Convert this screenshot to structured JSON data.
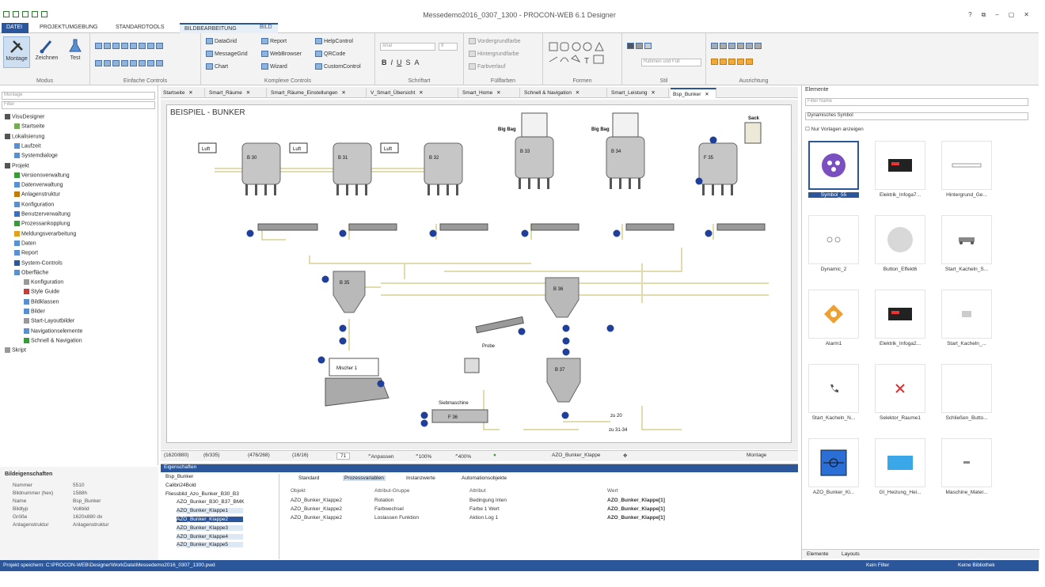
{
  "window": {
    "title": "Messedemo2016_0307_1300 - PROCON-WEB 6.1 Designer"
  },
  "ribbon_tabs": [
    "DATEI",
    "PROJEKTUMGEBUNG",
    "STANDARDTOOLS",
    "BILDBEARBEITUNG",
    "BILD"
  ],
  "ribbon": {
    "modus": {
      "label": "Modus",
      "buttons": [
        "Montage",
        "Zeichnen",
        "Test"
      ]
    },
    "einfache": {
      "label": "Einfache Controls"
    },
    "komplexe": {
      "label": "Komplexe Controls",
      "items": [
        "DataGrid",
        "MessageGrid",
        "Chart",
        "Report",
        "WebBrowser",
        "Wizard",
        "HelpControl",
        "QRCode",
        "CustomControl"
      ]
    },
    "schrift": {
      "label": "Schriftart",
      "font": "Arial",
      "size": "9"
    },
    "fuellfarben": {
      "label": "Füllfarben",
      "items": [
        "Vordergrundfarbe",
        "Hintergrundfarbe",
        "Farbverlauf"
      ]
    },
    "formen": {
      "label": "Formen"
    },
    "stil": {
      "label": "Stil",
      "rahmen": "Rahmen und Füll"
    },
    "ausrichtung": {
      "label": "Ausrichtung"
    }
  },
  "left": {
    "search_placeholder": "Montage",
    "filter_placeholder": "Filter",
    "tree": [
      "VisuDesigner",
      "Startseite",
      "Lokalisierung",
      "Laufzeit",
      "Systemdialoge",
      "Projekt",
      "Versionsverwaltung",
      "Datenverwaltung",
      "Anlagenstruktur",
      "Konfiguration",
      "Benutzerverwaltung",
      "Prozessankopplung",
      "Meldungsverarbeitung",
      "Daten",
      "Report",
      "System-Controls",
      "Oberfläche",
      "Konfiguration",
      "Style Guide",
      "Bildklassen",
      "Bilder",
      "Start-Layoutbilder",
      "Navigationselemente",
      "Schnell & Navigation",
      "Skript"
    ]
  },
  "props": {
    "title": "Bildeigenschaften",
    "rows": [
      {
        "k": "Nummer",
        "v": "5510"
      },
      {
        "k": "Bildnummer (hex)",
        "v": "1588h"
      },
      {
        "k": "Name",
        "v": "Bsp_Bunker"
      },
      {
        "k": "Bildtyp",
        "v": "Vollbild"
      },
      {
        "k": "Größe",
        "v": "1620x880 dx"
      },
      {
        "k": "Anlagenstruktur",
        "v": "Anlagenstruktur"
      }
    ]
  },
  "doc_tabs": [
    "Startseite",
    "Smart_Räume",
    "Smart_Räume_Einstellungen",
    "V_Smart_Übersicht",
    "Smart_Home",
    "Schnell & Navigation",
    "Smart_Leistung",
    "Bsp_Bunker"
  ],
  "drawing": {
    "title": "BEISPIEL - BUNKER",
    "labels": [
      "Big Bag",
      "Big Bag",
      "Sack",
      "Mischer 1",
      "Probe",
      "Siebmaschine",
      "zu 20",
      "zu 31-34"
    ],
    "tanks": [
      "B 30",
      "B 31",
      "B 32",
      "B 33",
      "B 34",
      "F 35",
      "B 36",
      "B 37"
    ],
    "luft": "Luft"
  },
  "status": {
    "coords1": "(1620/880)",
    "coords2": "(6/335)",
    "coords3": "(476/268)",
    "coords4": "(16/16)",
    "zoom_value": "71",
    "fit": "Anpassen",
    "zoom100": "100%",
    "zoom400": "400%",
    "selected": "AZO_Bunker_Klappe",
    "mode": "Montage"
  },
  "bottom": {
    "header": "Eigenschaften",
    "objects": [
      "Bsp_Bunker",
      "Calibri24Bold",
      "Fliessbild_Azo_Bunker_B30_B3",
      "AZO_Bunker_B30_B37_BMK",
      "AZO_Bunker_Klappe1",
      "AZO_Bunker_Klappe2",
      "AZO_Bunker_Klappe3",
      "AZO_Bunker_Klappe4",
      "AZO_Bunker_Klappe5"
    ],
    "tabs": [
      "Standard",
      "Prozessvariablen",
      "Instanzwerte",
      "Automationsobjekte"
    ],
    "columns": [
      "Objekt",
      "Attribut-Gruppe",
      "Attribut",
      "Wert"
    ],
    "rows": [
      [
        "AZO_Bunker_Klappe2",
        "Rotation",
        "Bedingung Inlen",
        "AZO_Bunker_Klappe[1]"
      ],
      [
        "AZO_Bunker_Klappe2",
        "Farbwechsel",
        "Farbe 1 Wert",
        "AZO_Bunker_Klappe[1]"
      ],
      [
        "AZO_Bunker_Klappe2",
        "Loslassen Funktion",
        "Aktion Log 1",
        "AZO_Bunker_Klappe[1]"
      ]
    ]
  },
  "right": {
    "header": "Elemente",
    "filter_placeholder": "Filter Name",
    "category": "Dynamisches Symbol",
    "checkbox": "Nur Vorlagen anzeigen",
    "elements": [
      "Symbol_55",
      "Elektrik_Infoga7...",
      "Hintergrund_Ge...",
      "Dynamic_2",
      "Button_Effekt6",
      "Start_Kacheln_S...",
      "Alarm1",
      "Elektrik_Infoga2...",
      "Start_Kacheln_...",
      "Start_Kacheln_N...",
      "Selektor_Raume1",
      "Schließen_Butto...",
      "AZO_Bunker_Kl...",
      "GI_Heizung_Hei...",
      "Maschine_Mater..."
    ],
    "bottom_tabs": [
      "Elemente",
      "Layouts"
    ]
  },
  "statusbar": {
    "path": "Projekt speichern: C:\\PROCON-WEB\\Designer\\WorkData\\Messedemo2016_0307_1300.pwd",
    "filter": "Kein Filter",
    "library": "Keine Bibliothek"
  }
}
